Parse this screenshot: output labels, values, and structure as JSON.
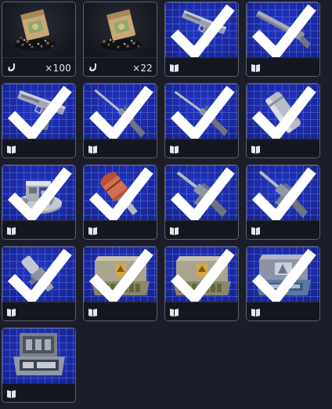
{
  "inventory": {
    "slots": [
      {
        "item": "seed-packet-icon",
        "type": "gesture",
        "quantity": "×100",
        "owned": false,
        "art": "dark"
      },
      {
        "item": "seed-packet-icon",
        "type": "gesture",
        "quantity": "×22",
        "owned": false,
        "art": "dark"
      },
      {
        "item": "pistol-blueprint-icon",
        "type": "blueprint",
        "quantity": "",
        "owned": true,
        "art": "blueprint"
      },
      {
        "item": "shotgun-blueprint-icon",
        "type": "blueprint",
        "quantity": "",
        "owned": true,
        "art": "blueprint"
      },
      {
        "item": "pistol-blueprint-icon",
        "type": "blueprint",
        "quantity": "",
        "owned": true,
        "art": "blueprint"
      },
      {
        "item": "sniper-rifle-blueprint-icon",
        "type": "blueprint",
        "quantity": "",
        "owned": true,
        "art": "blueprint"
      },
      {
        "item": "sniper-rifle-blueprint-icon",
        "type": "blueprint",
        "quantity": "",
        "owned": true,
        "art": "blueprint"
      },
      {
        "item": "ammo-canister-blueprint-icon",
        "type": "blueprint",
        "quantity": "",
        "owned": true,
        "art": "blueprint"
      },
      {
        "item": "turret-device-blueprint-icon",
        "type": "blueprint",
        "quantity": "",
        "owned": true,
        "art": "blueprint"
      },
      {
        "item": "rocket-blueprint-icon",
        "type": "blueprint",
        "quantity": "",
        "owned": true,
        "art": "blueprint"
      },
      {
        "item": "assault-rifle-blueprint-icon",
        "type": "blueprint",
        "quantity": "",
        "owned": true,
        "art": "blueprint"
      },
      {
        "item": "assault-rifle-blueprint-icon",
        "type": "blueprint",
        "quantity": "",
        "owned": true,
        "art": "blueprint"
      },
      {
        "item": "weapon-part-blueprint-icon",
        "type": "blueprint",
        "quantity": "",
        "owned": true,
        "art": "blueprint"
      },
      {
        "item": "ammo-crate-blueprint-icon",
        "type": "blueprint",
        "quantity": "",
        "owned": true,
        "art": "blueprint"
      },
      {
        "item": "ammo-crate-blueprint-icon",
        "type": "blueprint",
        "quantity": "",
        "owned": true,
        "art": "blueprint"
      },
      {
        "item": "tool-case-blueprint-icon",
        "type": "blueprint",
        "quantity": "",
        "owned": true,
        "art": "blueprint"
      },
      {
        "item": "open-tool-case-blueprint-icon",
        "type": "blueprint",
        "quantity": "",
        "owned": false,
        "art": "blueprint"
      }
    ]
  }
}
